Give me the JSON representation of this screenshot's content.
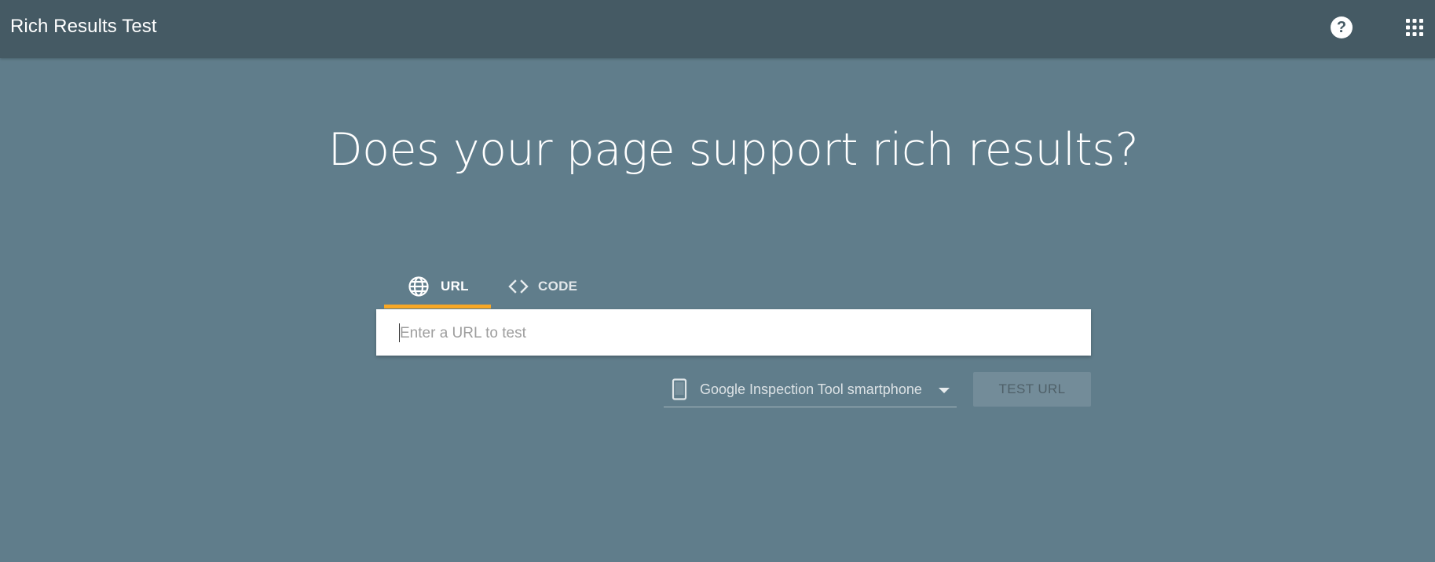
{
  "header": {
    "title": "Rich Results Test",
    "help_symbol": "?",
    "help_icon": "help-circle-icon",
    "apps_icon": "apps-grid-icon"
  },
  "main": {
    "headline": "Does your page support rich results?",
    "tabs": [
      {
        "label": "URL",
        "icon": "globe-icon",
        "selected": true
      },
      {
        "label": "CODE",
        "icon": "code-brackets-icon",
        "selected": false
      }
    ],
    "url_input": {
      "value": "",
      "placeholder": "Enter a URL to test"
    },
    "device_select": {
      "icon": "smartphone-icon",
      "selected": "Google Inspection Tool smartphone"
    },
    "test_button": {
      "label": "TEST URL",
      "enabled": false
    }
  },
  "colors": {
    "topbar": "#455a64",
    "background": "#607d8b",
    "tab_indicator": "#f9a825"
  }
}
